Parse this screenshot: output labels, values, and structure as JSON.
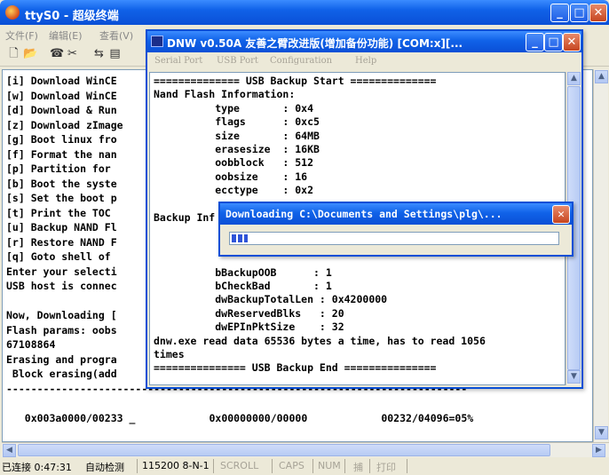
{
  "outer": {
    "title": "ttyS0 - 超级终端",
    "menu": [
      "文件(F)",
      "编辑(E)",
      "查看(V)"
    ],
    "toolbar_icons": [
      "new-file-icon",
      "open-folder-icon",
      "phone-icon",
      "disconnect-icon",
      "send-icon",
      "properties-icon"
    ],
    "terminal_lines": [
      "[i] Download WinCE",
      "[w] Download WinCE",
      "[d] Download & Run",
      "[z] Download zImage",
      "[g] Boot linux fro",
      "[f] Format the nan",
      "[p] Partition for",
      "[b] Boot the syste",
      "[s] Set the boot p",
      "[t] Print the TOC",
      "[u] Backup NAND Fl",
      "[r] Restore NAND F",
      "[q] Goto shell of",
      "Enter your selecti",
      "USB host is connec",
      "",
      "Now, Downloading [",
      "Flash params: oobs",
      "67108864",
      "Erasing and progra",
      " Block erasing(add",
      "---------------------------------------------------------------------------",
      "",
      "   0x003a0000/00233 _            0x00000000/00000            00232/04096=05%"
    ],
    "status": {
      "connected": "已连接 0:47:31",
      "detect": "自动检测",
      "baud": "115200 8-N-1",
      "scroll": "SCROLL",
      "caps": "CAPS",
      "num": "NUM",
      "capture": "捕",
      "print": "打印"
    }
  },
  "inner": {
    "title": "DNW v0.50A 友善之臂改进版(增加备份功能)   [COM:x][...",
    "menu": [
      "Serial Port",
      "USB Port",
      "Configuration",
      "Help"
    ],
    "terminal_lines": [
      "============== USB Backup Start ==============",
      "Nand Flash Information:",
      "          type       : 0x4",
      "          flags      : 0xc5",
      "          size       : 64MB",
      "          erasesize  : 16KB",
      "          oobblock   : 512",
      "          oobsize    : 16",
      "          ecctype    : 0x2",
      "",
      "Backup Inf",
      "",
      "",
      "",
      "          bBackupOOB      : 1",
      "          bCheckBad       : 1",
      "          dwBackupTotalLen : 0x4200000",
      "          dwReservedBlks   : 20",
      "          dwEPInPktSize    : 32",
      "dnw.exe read data 65536 bytes a time, has to read 1056",
      "times",
      "=============== USB Backup End ==============="
    ]
  },
  "download_dialog": {
    "title": "Downloading C:\\Documents and Settings\\plg\\...",
    "progress": 0.05
  },
  "colors": {
    "titlebar": "#0A4FD6",
    "progress": "#2f54d8",
    "close": "#c6451f"
  }
}
